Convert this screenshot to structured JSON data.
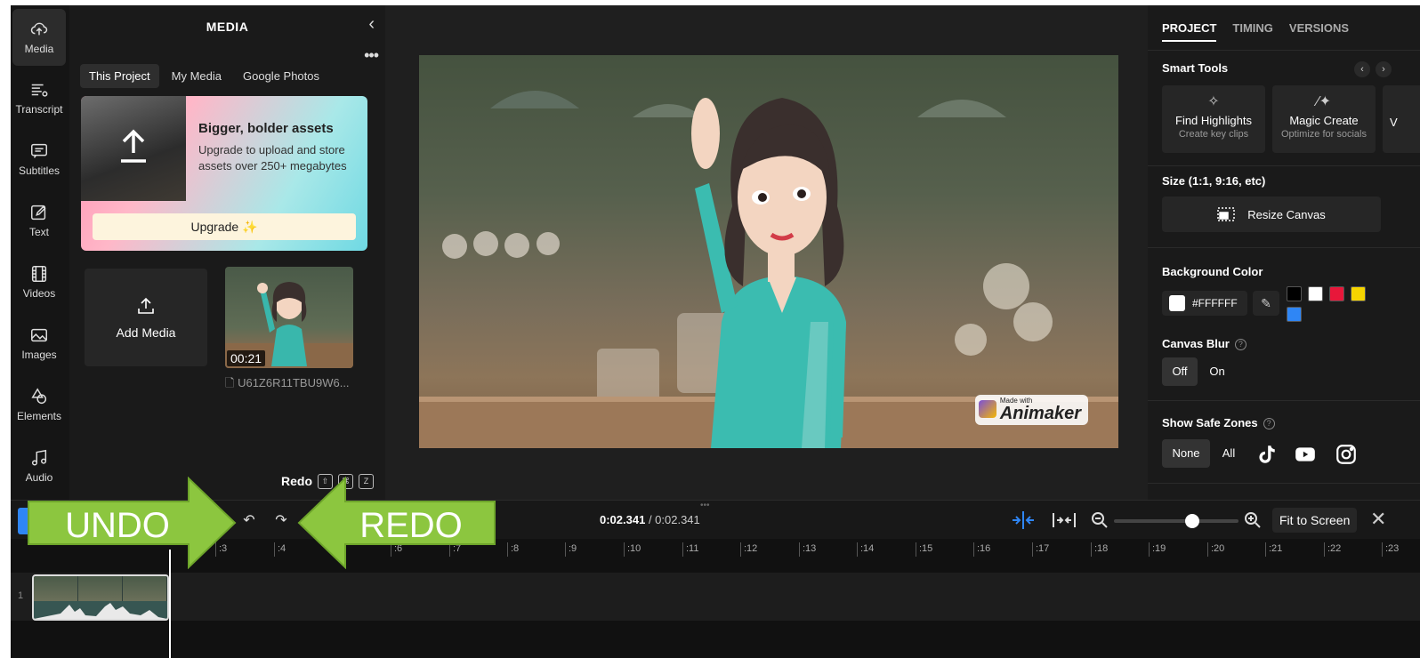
{
  "rail": {
    "items": [
      {
        "label": "Media",
        "icon": "cloud-upload-icon"
      },
      {
        "label": "Transcript",
        "icon": "transcript-icon"
      },
      {
        "label": "Subtitles",
        "icon": "subtitles-icon"
      },
      {
        "label": "Text",
        "icon": "text-edit-icon"
      },
      {
        "label": "Videos",
        "icon": "film-icon"
      },
      {
        "label": "Images",
        "icon": "image-icon"
      },
      {
        "label": "Elements",
        "icon": "shapes-icon"
      },
      {
        "label": "Audio",
        "icon": "music-note-icon"
      }
    ]
  },
  "media_panel": {
    "title": "MEDIA",
    "tabs": [
      "This Project",
      "My Media",
      "Google Photos"
    ],
    "promo": {
      "title": "Bigger, bolder assets",
      "text": "Upgrade to upload and store assets over 250+ megabytes",
      "button": "Upgrade ✨"
    },
    "add_media": "Add Media",
    "thumb_duration": "00:21",
    "filename": "U61Z6R11TBU9W6...",
    "tooltip": {
      "label": "Redo",
      "keys": [
        "⇧",
        "⌘",
        "Z"
      ]
    }
  },
  "watermark": {
    "small": "Made with",
    "big": "Animaker"
  },
  "props": {
    "tabs": [
      "PROJECT",
      "TIMING",
      "VERSIONS"
    ],
    "smart_tools_title": "Smart Tools",
    "tools": [
      {
        "title": "Find Highlights",
        "sub": "Create key clips",
        "icon": "sparkle-icon"
      },
      {
        "title": "Magic Create",
        "sub": "Optimize for socials",
        "icon": "magic-wand-icon"
      },
      {
        "title": "V",
        "sub": "",
        "icon": ""
      }
    ],
    "size_title": "Size (1:1, 9:16, etc)",
    "resize_button": "Resize Canvas",
    "bg_title": "Background Color",
    "bg_value": "#FFFFFF",
    "swatches": [
      "#000000",
      "#FFFFFF",
      "#E8173A",
      "#F5D400",
      "#2F86F5"
    ],
    "blur_title": "Canvas Blur",
    "blur_options": [
      "Off",
      "On"
    ],
    "safe_title": "Show Safe Zones",
    "safe_options": [
      "None",
      "All"
    ]
  },
  "timeline": {
    "current": "0:02.341",
    "total": " / 0:02.341",
    "fit_button": "Fit to Screen",
    "zoom_level": 0.63,
    "ticks": [
      ":3",
      ":4",
      ":6",
      ":7",
      ":8",
      ":9",
      ":10",
      ":11",
      ":12",
      ":13",
      ":14",
      ":15",
      ":16",
      ":17",
      ":18",
      ":19",
      ":20",
      ":21",
      ":22",
      ":23"
    ],
    "track_number": "1"
  },
  "annotations": {
    "undo": "UNDO",
    "redo": "REDO",
    "color": "#8cc63f"
  }
}
